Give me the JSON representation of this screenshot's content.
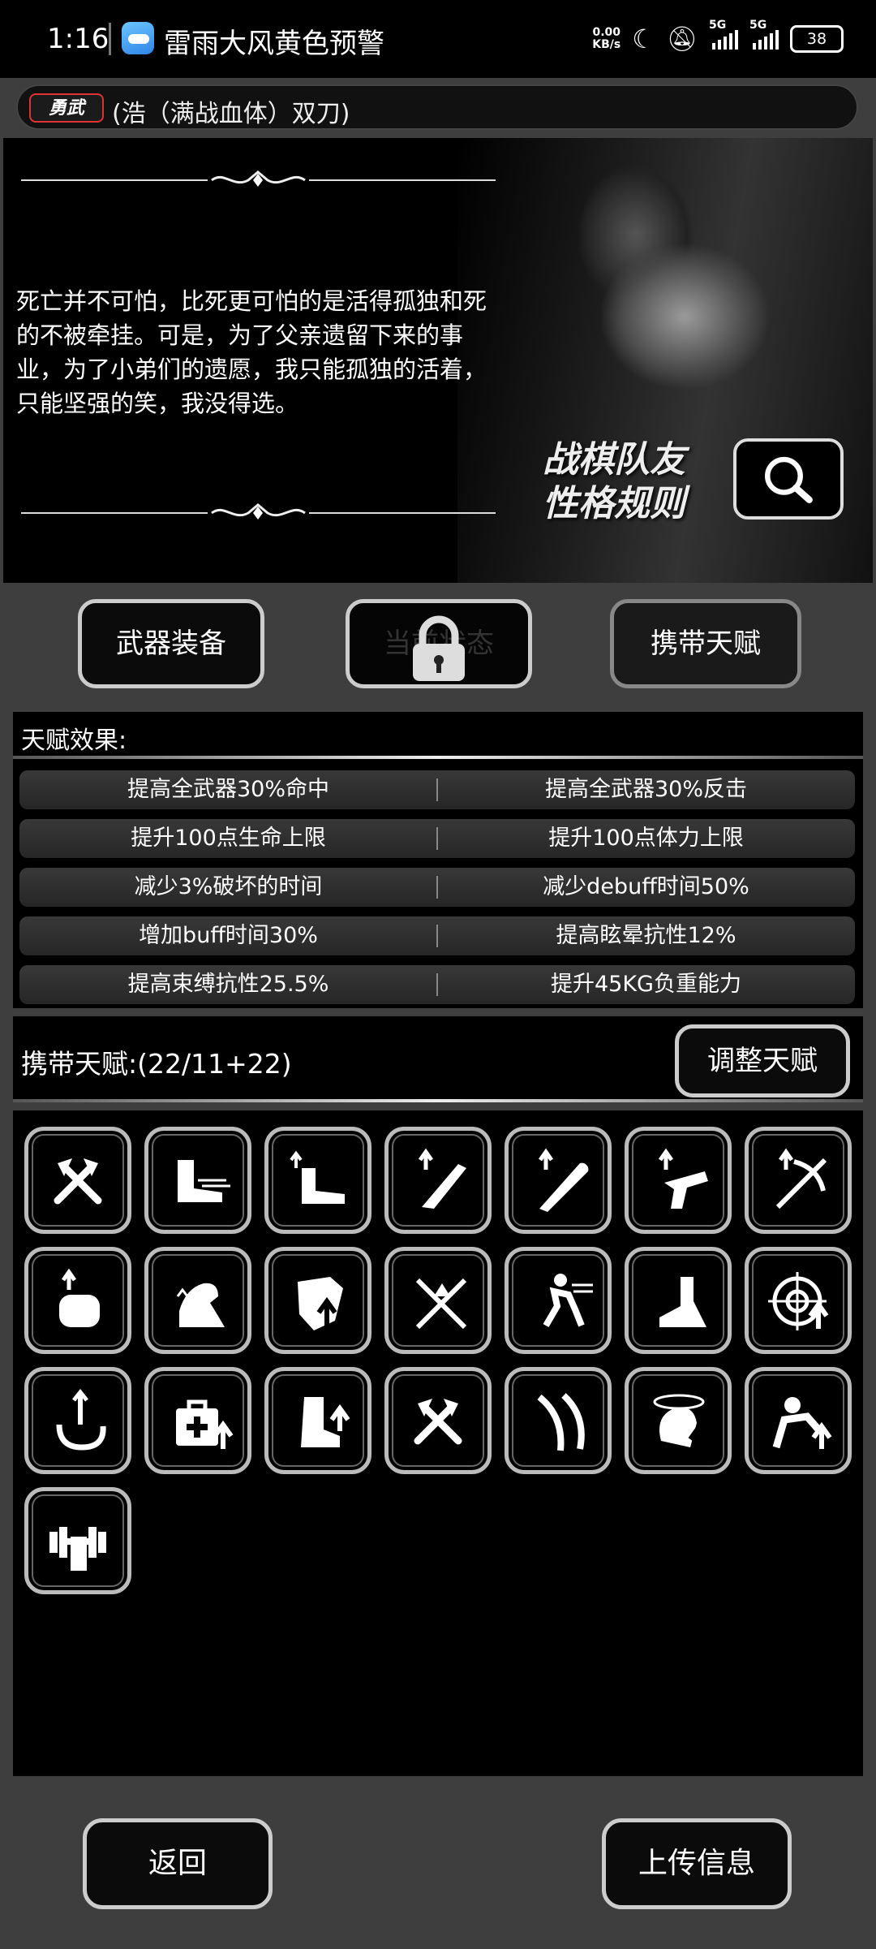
{
  "status_bar": {
    "time": "1:16",
    "notification": "雷雨大风黄色预警",
    "net_speed_value": "0.00",
    "net_speed_unit": "KB/s",
    "signal1": "5G",
    "signal2": "5G",
    "battery": "38"
  },
  "character": {
    "badge": "勇武",
    "name": "(浩（满战血体）双刀)"
  },
  "story": {
    "text": "死亡并不可怕，比死更可怕的是活得孤独和死的不被牵挂。可是，为了父亲遗留下来的事业，为了小弟们的遗愿，我只能孤独的活着，只能坚强的笑，我没得选。",
    "rules_line1": "战棋队友",
    "rules_line2": "性格规则"
  },
  "tabs": [
    {
      "label": "武器装备"
    },
    {
      "label": "当前状态"
    },
    {
      "label": "携带天赋"
    }
  ],
  "effects": {
    "title": "天赋效果:",
    "rows": [
      {
        "left": "提高全武器30%命中",
        "right": "提高全武器30%反击"
      },
      {
        "left": "提升100点生命上限",
        "right": "提升100点体力上限"
      },
      {
        "left": "减少3%破坏的时间",
        "right": "减少debuff时间50%"
      },
      {
        "left": "增加buff时间30%",
        "right": "提高眩晕抗性12%"
      },
      {
        "left": "提高束缚抗性25.5%",
        "right": "提升45KG负重能力"
      }
    ]
  },
  "carry": {
    "label": "携带天赋:(22/11+22)",
    "adjust_button": "调整天赋"
  },
  "talents": [
    "crossed-axes-icon",
    "sprint-boot-icon",
    "boot-speed-up-icon",
    "machete-up-icon",
    "bat-up-icon",
    "pistol-up-icon",
    "crossbow-up-icon",
    "arm-guard-up-icon",
    "flexed-arm-icon",
    "shield-up-icon",
    "crossed-swords-icon",
    "running-figure-icon",
    "leg-icon",
    "target-up-icon",
    "grapple-hook-icon",
    "medkit-up-icon",
    "boot-up-icon",
    "crossed-axes-icon",
    "ribbons-icon",
    "dizzy-head-up-icon",
    "strength-up-icon",
    "dumbbell-icon"
  ],
  "bottom": {
    "back": "返回",
    "upload": "上传信息"
  }
}
